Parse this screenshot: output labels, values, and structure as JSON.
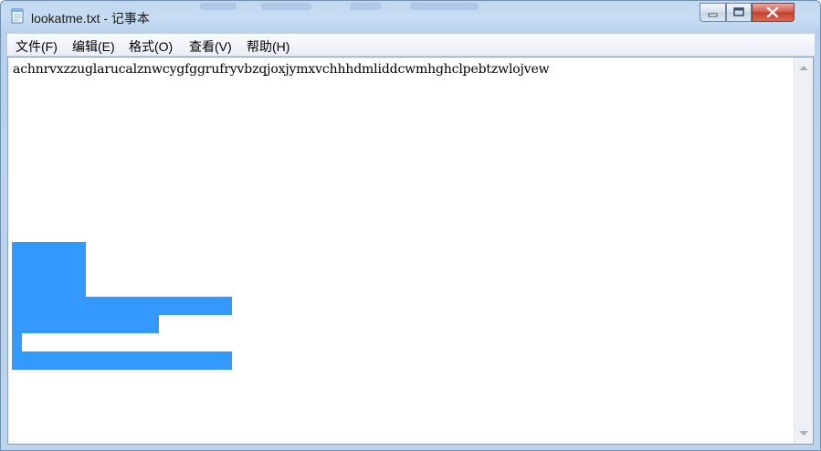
{
  "window": {
    "title": "lookatme.txt - 记事本",
    "icon": "notepad-icon",
    "controls": {
      "minimize": "minimize-icon",
      "maximize": "maximize-icon",
      "close": "close-icon"
    }
  },
  "menu": {
    "items": [
      {
        "label": "文件(F)"
      },
      {
        "label": "编辑(E)"
      },
      {
        "label": "格式(O)"
      },
      {
        "label": "查看(V)"
      },
      {
        "label": "帮助(H)"
      }
    ]
  },
  "editor": {
    "content": "achnrvxzzuglarucalznwcygfggrufryvbzqjoxjymxvchhhdmliddcwmhghclpebtzwlojvew"
  },
  "colors": {
    "selection": "#3399ff",
    "close_button": "#c43c2b",
    "title_bar": "#c2d8ef"
  }
}
